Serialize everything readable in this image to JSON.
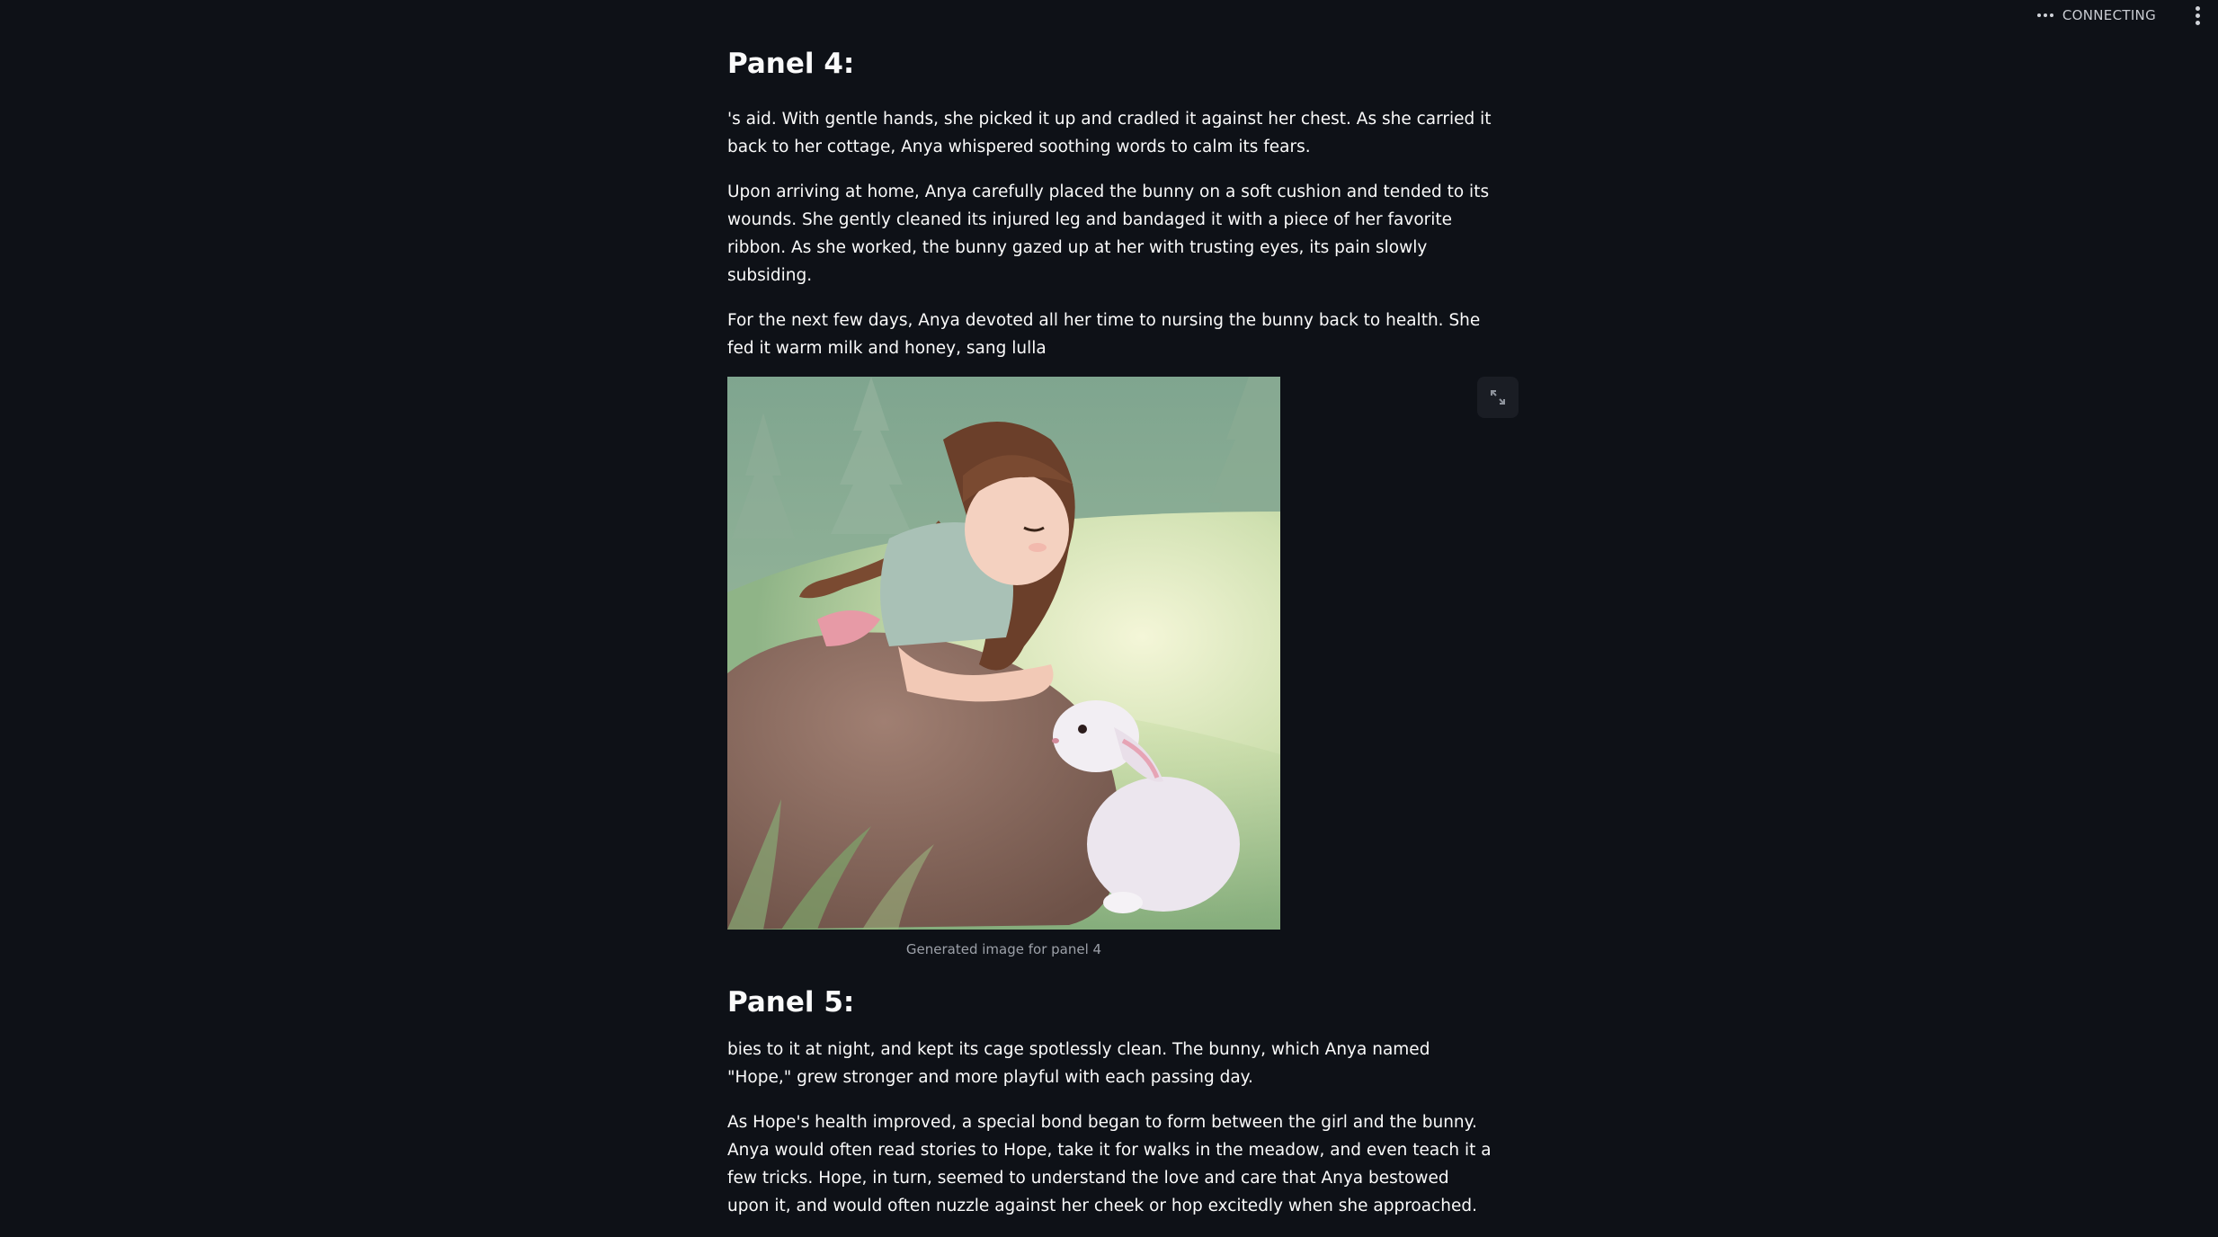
{
  "status": {
    "icon": "running-dots-icon",
    "text": "CONNECTING"
  },
  "menu": {
    "icon": "kebab-menu-icon"
  },
  "panel4": {
    "heading": "Panel 4:",
    "paragraphs": [
      "'s aid. With gentle hands, she picked it up and cradled it against her chest. As she carried it back to her cottage, Anya whispered soothing words to calm its fears.",
      "Upon arriving at home, Anya carefully placed the bunny on a soft cushion and tended to its wounds. She gently cleaned its injured leg and bandaged it with a piece of her favorite ribbon. As she worked, the bunny gazed up at her with trusting eyes, its pain slowly subsiding.",
      "For the next few days, Anya devoted all her time to nursing the bunny back to health. She fed it warm milk and honey, sang lulla"
    ],
    "image_caption": "Generated image for panel 4",
    "expand_icon": "fullscreen-expand-icon"
  },
  "panel5": {
    "heading": "Panel 5:",
    "paragraphs": [
      "bies to it at night, and kept its cage spotlessly clean. The bunny, which Anya named \"Hope,\" grew stronger and more playful with each passing day.",
      "As Hope's health improved, a special bond began to form between the girl and the bunny. Anya would often read stories to Hope, take it for walks in the meadow, and even teach it a few tricks. Hope, in turn, seemed to understand the love and care that Anya bestowed upon it, and would often nuzzle against her cheek or hop excitedly when she approached."
    ]
  }
}
